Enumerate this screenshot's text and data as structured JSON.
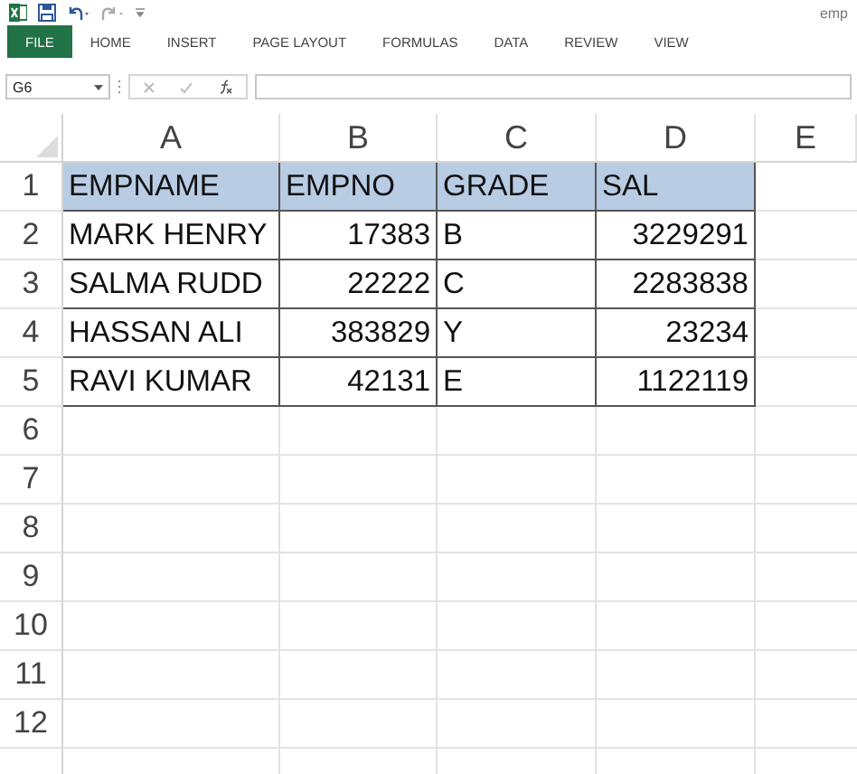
{
  "window": {
    "file_name": "emp"
  },
  "ribbon_tabs": [
    {
      "label": "FILE",
      "selected": true
    },
    {
      "label": "HOME",
      "selected": false
    },
    {
      "label": "INSERT",
      "selected": false
    },
    {
      "label": "PAGE LAYOUT",
      "selected": false
    },
    {
      "label": "FORMULAS",
      "selected": false
    },
    {
      "label": "DATA",
      "selected": false
    },
    {
      "label": "REVIEW",
      "selected": false
    },
    {
      "label": "VIEW",
      "selected": false
    }
  ],
  "formula_bar": {
    "name_box": "G6"
  },
  "sheet": {
    "columns": [
      {
        "letter": "A",
        "kind": "text"
      },
      {
        "letter": "B",
        "kind": "number"
      },
      {
        "letter": "C",
        "kind": "text"
      },
      {
        "letter": "D",
        "kind": "number"
      },
      {
        "letter": "E",
        "kind": "text"
      }
    ],
    "header_row": {
      "number": "1",
      "cells": [
        "EMPNAME",
        "EMPNO",
        "GRADE",
        "SAL"
      ]
    },
    "rows": [
      {
        "number": "2",
        "cells": [
          "MARK HENRY",
          "17383",
          "B",
          "3229291"
        ]
      },
      {
        "number": "3",
        "cells": [
          "SALMA RUDD",
          "22222",
          "C",
          "2283838"
        ]
      },
      {
        "number": "4",
        "cells": [
          "HASSAN ALI",
          "383829",
          "Y",
          "23234"
        ]
      },
      {
        "number": "5",
        "cells": [
          "RAVI KUMAR",
          "42131",
          "E",
          "1122119"
        ]
      },
      {
        "number": "6"
      },
      {
        "number": "7"
      },
      {
        "number": "8"
      },
      {
        "number": "9"
      },
      {
        "number": "10"
      },
      {
        "number": "11"
      },
      {
        "number": "12"
      }
    ]
  }
}
